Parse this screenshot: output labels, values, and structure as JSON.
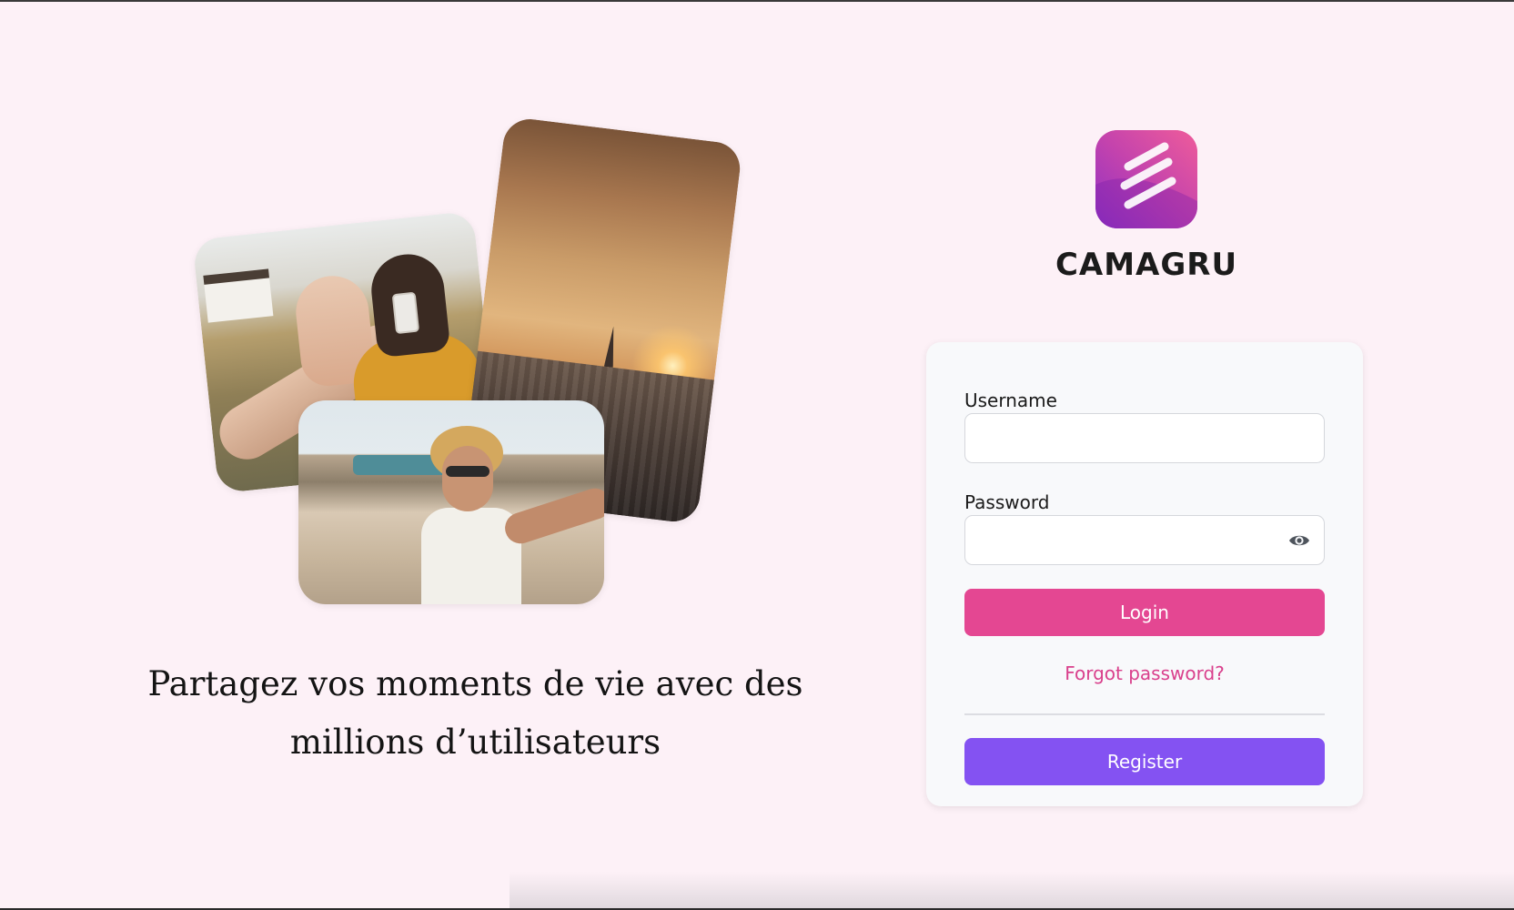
{
  "brand": {
    "name": "CAMAGRU",
    "logo_icon": "camagru-logo-icon",
    "colors": {
      "background": "#fdf1f7",
      "primary_pink": "#e44792",
      "link_pink": "#d9408c",
      "register_purple": "#8452f2",
      "logo_gradient": [
        "#ef5c9a",
        "#c443ad",
        "#8e31c4"
      ]
    }
  },
  "hero": {
    "tagline_line1": "Partagez vos moments de vie avec des",
    "tagline_line2": "millions d’utilisateurs",
    "photos": [
      "friends-selfie-photo",
      "paris-sunset-photo",
      "beach-selfie-photo"
    ]
  },
  "login_form": {
    "username_label": "Username",
    "username_value": "",
    "password_label": "Password",
    "password_value": "",
    "password_toggle_icon": "eye-icon",
    "login_button": "Login",
    "forgot_link": "Forgot password?",
    "register_button": "Register"
  }
}
